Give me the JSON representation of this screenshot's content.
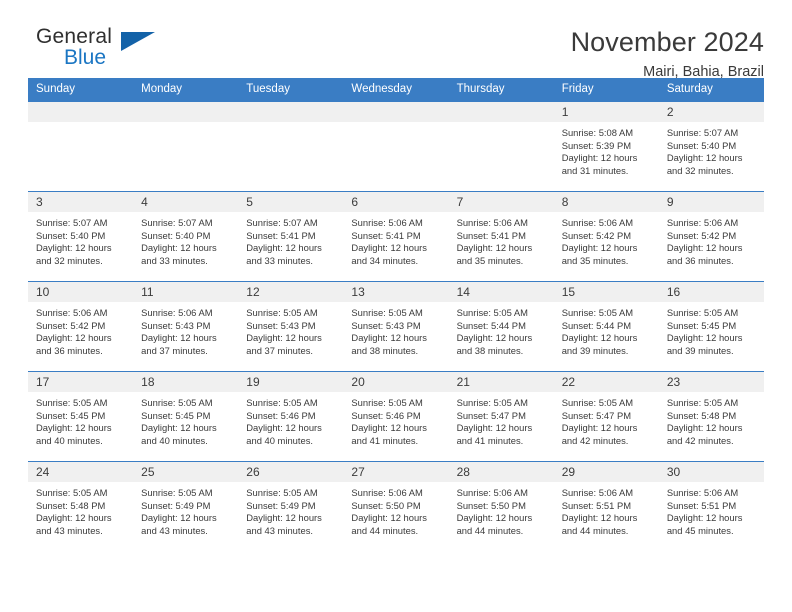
{
  "logo": {
    "line1": "General",
    "line2": "Blue",
    "icon": "triangle-icon",
    "accent_color": "#1362a8"
  },
  "header": {
    "title": "November 2024",
    "subtitle": "Mairi, Bahia, Brazil",
    "header_bg": "#3a7dc4"
  },
  "calendar": {
    "weekday_headers": [
      "Sunday",
      "Monday",
      "Tuesday",
      "Wednesday",
      "Thursday",
      "Friday",
      "Saturday"
    ],
    "weeks": [
      [
        {
          "day": "",
          "sunrise": "",
          "sunset": "",
          "daylight1": "",
          "daylight2": ""
        },
        {
          "day": "",
          "sunrise": "",
          "sunset": "",
          "daylight1": "",
          "daylight2": ""
        },
        {
          "day": "",
          "sunrise": "",
          "sunset": "",
          "daylight1": "",
          "daylight2": ""
        },
        {
          "day": "",
          "sunrise": "",
          "sunset": "",
          "daylight1": "",
          "daylight2": ""
        },
        {
          "day": "",
          "sunrise": "",
          "sunset": "",
          "daylight1": "",
          "daylight2": ""
        },
        {
          "day": "1",
          "sunrise": "Sunrise: 5:08 AM",
          "sunset": "Sunset: 5:39 PM",
          "daylight1": "Daylight: 12 hours",
          "daylight2": "and 31 minutes."
        },
        {
          "day": "2",
          "sunrise": "Sunrise: 5:07 AM",
          "sunset": "Sunset: 5:40 PM",
          "daylight1": "Daylight: 12 hours",
          "daylight2": "and 32 minutes."
        }
      ],
      [
        {
          "day": "3",
          "sunrise": "Sunrise: 5:07 AM",
          "sunset": "Sunset: 5:40 PM",
          "daylight1": "Daylight: 12 hours",
          "daylight2": "and 32 minutes."
        },
        {
          "day": "4",
          "sunrise": "Sunrise: 5:07 AM",
          "sunset": "Sunset: 5:40 PM",
          "daylight1": "Daylight: 12 hours",
          "daylight2": "and 33 minutes."
        },
        {
          "day": "5",
          "sunrise": "Sunrise: 5:07 AM",
          "sunset": "Sunset: 5:41 PM",
          "daylight1": "Daylight: 12 hours",
          "daylight2": "and 33 minutes."
        },
        {
          "day": "6",
          "sunrise": "Sunrise: 5:06 AM",
          "sunset": "Sunset: 5:41 PM",
          "daylight1": "Daylight: 12 hours",
          "daylight2": "and 34 minutes."
        },
        {
          "day": "7",
          "sunrise": "Sunrise: 5:06 AM",
          "sunset": "Sunset: 5:41 PM",
          "daylight1": "Daylight: 12 hours",
          "daylight2": "and 35 minutes."
        },
        {
          "day": "8",
          "sunrise": "Sunrise: 5:06 AM",
          "sunset": "Sunset: 5:42 PM",
          "daylight1": "Daylight: 12 hours",
          "daylight2": "and 35 minutes."
        },
        {
          "day": "9",
          "sunrise": "Sunrise: 5:06 AM",
          "sunset": "Sunset: 5:42 PM",
          "daylight1": "Daylight: 12 hours",
          "daylight2": "and 36 minutes."
        }
      ],
      [
        {
          "day": "10",
          "sunrise": "Sunrise: 5:06 AM",
          "sunset": "Sunset: 5:42 PM",
          "daylight1": "Daylight: 12 hours",
          "daylight2": "and 36 minutes."
        },
        {
          "day": "11",
          "sunrise": "Sunrise: 5:06 AM",
          "sunset": "Sunset: 5:43 PM",
          "daylight1": "Daylight: 12 hours",
          "daylight2": "and 37 minutes."
        },
        {
          "day": "12",
          "sunrise": "Sunrise: 5:05 AM",
          "sunset": "Sunset: 5:43 PM",
          "daylight1": "Daylight: 12 hours",
          "daylight2": "and 37 minutes."
        },
        {
          "day": "13",
          "sunrise": "Sunrise: 5:05 AM",
          "sunset": "Sunset: 5:43 PM",
          "daylight1": "Daylight: 12 hours",
          "daylight2": "and 38 minutes."
        },
        {
          "day": "14",
          "sunrise": "Sunrise: 5:05 AM",
          "sunset": "Sunset: 5:44 PM",
          "daylight1": "Daylight: 12 hours",
          "daylight2": "and 38 minutes."
        },
        {
          "day": "15",
          "sunrise": "Sunrise: 5:05 AM",
          "sunset": "Sunset: 5:44 PM",
          "daylight1": "Daylight: 12 hours",
          "daylight2": "and 39 minutes."
        },
        {
          "day": "16",
          "sunrise": "Sunrise: 5:05 AM",
          "sunset": "Sunset: 5:45 PM",
          "daylight1": "Daylight: 12 hours",
          "daylight2": "and 39 minutes."
        }
      ],
      [
        {
          "day": "17",
          "sunrise": "Sunrise: 5:05 AM",
          "sunset": "Sunset: 5:45 PM",
          "daylight1": "Daylight: 12 hours",
          "daylight2": "and 40 minutes."
        },
        {
          "day": "18",
          "sunrise": "Sunrise: 5:05 AM",
          "sunset": "Sunset: 5:45 PM",
          "daylight1": "Daylight: 12 hours",
          "daylight2": "and 40 minutes."
        },
        {
          "day": "19",
          "sunrise": "Sunrise: 5:05 AM",
          "sunset": "Sunset: 5:46 PM",
          "daylight1": "Daylight: 12 hours",
          "daylight2": "and 40 minutes."
        },
        {
          "day": "20",
          "sunrise": "Sunrise: 5:05 AM",
          "sunset": "Sunset: 5:46 PM",
          "daylight1": "Daylight: 12 hours",
          "daylight2": "and 41 minutes."
        },
        {
          "day": "21",
          "sunrise": "Sunrise: 5:05 AM",
          "sunset": "Sunset: 5:47 PM",
          "daylight1": "Daylight: 12 hours",
          "daylight2": "and 41 minutes."
        },
        {
          "day": "22",
          "sunrise": "Sunrise: 5:05 AM",
          "sunset": "Sunset: 5:47 PM",
          "daylight1": "Daylight: 12 hours",
          "daylight2": "and 42 minutes."
        },
        {
          "day": "23",
          "sunrise": "Sunrise: 5:05 AM",
          "sunset": "Sunset: 5:48 PM",
          "daylight1": "Daylight: 12 hours",
          "daylight2": "and 42 minutes."
        }
      ],
      [
        {
          "day": "24",
          "sunrise": "Sunrise: 5:05 AM",
          "sunset": "Sunset: 5:48 PM",
          "daylight1": "Daylight: 12 hours",
          "daylight2": "and 43 minutes."
        },
        {
          "day": "25",
          "sunrise": "Sunrise: 5:05 AM",
          "sunset": "Sunset: 5:49 PM",
          "daylight1": "Daylight: 12 hours",
          "daylight2": "and 43 minutes."
        },
        {
          "day": "26",
          "sunrise": "Sunrise: 5:05 AM",
          "sunset": "Sunset: 5:49 PM",
          "daylight1": "Daylight: 12 hours",
          "daylight2": "and 43 minutes."
        },
        {
          "day": "27",
          "sunrise": "Sunrise: 5:06 AM",
          "sunset": "Sunset: 5:50 PM",
          "daylight1": "Daylight: 12 hours",
          "daylight2": "and 44 minutes."
        },
        {
          "day": "28",
          "sunrise": "Sunrise: 5:06 AM",
          "sunset": "Sunset: 5:50 PM",
          "daylight1": "Daylight: 12 hours",
          "daylight2": "and 44 minutes."
        },
        {
          "day": "29",
          "sunrise": "Sunrise: 5:06 AM",
          "sunset": "Sunset: 5:51 PM",
          "daylight1": "Daylight: 12 hours",
          "daylight2": "and 44 minutes."
        },
        {
          "day": "30",
          "sunrise": "Sunrise: 5:06 AM",
          "sunset": "Sunset: 5:51 PM",
          "daylight1": "Daylight: 12 hours",
          "daylight2": "and 45 minutes."
        }
      ]
    ]
  }
}
